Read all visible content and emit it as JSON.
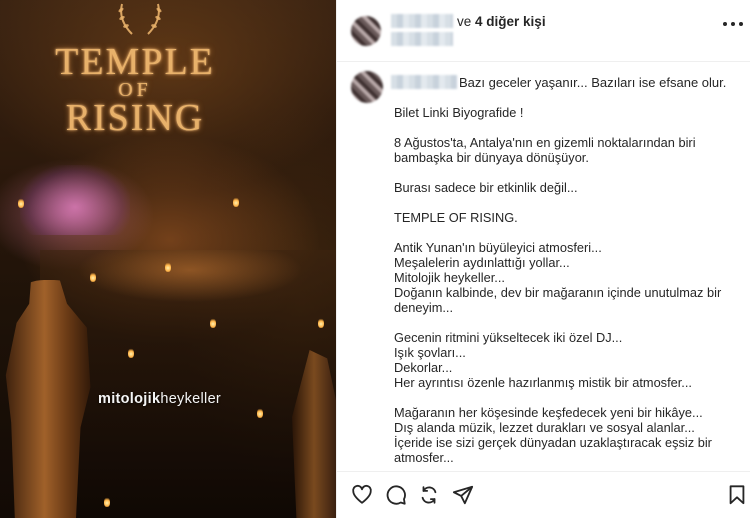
{
  "media": {
    "poster_title_1": "TEMPLE",
    "poster_title_2": "OF",
    "poster_title_3": "RISING",
    "overlay_bold": "mitolojik",
    "overlay_rest": "heykeller"
  },
  "header": {
    "suffix": "ve",
    "others": "4 diğer kişi"
  },
  "caption": {
    "first_line": "Bazı geceler yaşanır... Bazıları ise efsane olur.",
    "lines": [
      "Bilet Linki Biyografide !",
      "",
      "8 Ağustos'ta, Antalya'nın en gizemli noktalarından biri bambaşka bir dünyaya dönüşüyor.",
      "",
      "Burası sadece bir etkinlik değil...",
      "",
      "TEMPLE OF RISING.",
      "",
      "Antik Yunan'ın büyüleyici atmosferi...",
      "Meşalelerin aydınlattığı yollar...",
      "Mitolojik heykeller...",
      "Doğanın kalbinde, dev bir mağaranın içinde unutulmaz bir deneyim...",
      "",
      "Gecenin ritmini yükseltecek iki özel DJ...",
      "Işık şovları...",
      "Dekorlar...",
      "Her ayrıntısı özenle hazırlanmış mistik bir atmosfer...",
      "",
      "Mağaranın her köşesinde keşfedecek yeni bir hikâye...",
      "Dış alanda müzik, lezzet durakları ve sosyal alanlar...",
      "İçeride ise sizi gerçek dünyadan uzaklaştıracak eşsiz bir atmosfer..."
    ]
  },
  "icons": {
    "like": "heart-icon",
    "comment": "comment-icon",
    "repost": "repost-icon",
    "share": "share-icon",
    "save": "bookmark-icon",
    "more": "more-options-icon"
  },
  "colors": {
    "poster_gold": "#e8b16a",
    "text": "#262626",
    "divider": "#efefef"
  }
}
